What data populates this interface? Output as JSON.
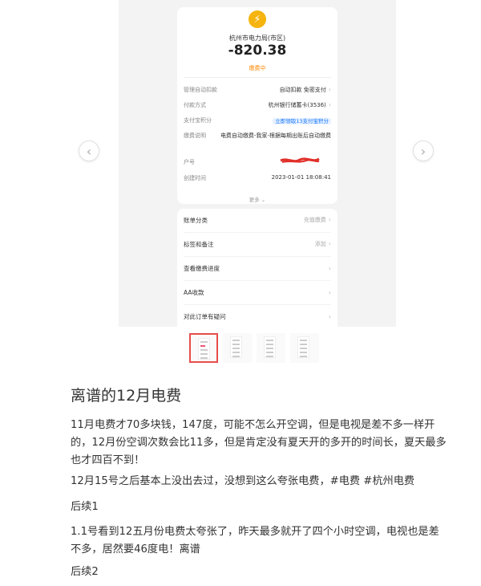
{
  "receipt": {
    "merchant": "杭州市电力局(市区)",
    "amount": "-820.38",
    "status": "缴费中",
    "rows": [
      {
        "label": "管理自动扣款",
        "value": "自动扣款 免密支付"
      },
      {
        "label": "付款方式",
        "value": "杭州银行储蓄卡(3536)"
      },
      {
        "label": "支付宝积分",
        "value": "立即领取13支付宝积分"
      },
      {
        "label": "缴费说明",
        "value": "电费自动缴费-我家-根据每期出账后自动缴费"
      },
      {
        "label": "户号",
        "value": ""
      },
      {
        "label": "创建时间",
        "value": "2023-01-01 18:08:41"
      }
    ],
    "more": "更多 ⌄"
  },
  "menu": [
    {
      "label": "账单分类",
      "hint": "充值缴费"
    },
    {
      "label": "标签和备注",
      "hint": "添加"
    },
    {
      "label": "查看缴费进度",
      "hint": ""
    },
    {
      "label": "AA收款",
      "hint": ""
    },
    {
      "label": "对此订单有疑问",
      "hint": ""
    }
  ],
  "icons": {
    "prev": "chevron-left-icon",
    "next": "chevron-right-icon",
    "bolt": "lightning-icon"
  },
  "colors": {
    "accent": "#f5b40e",
    "status": "#ff8a00",
    "thumb_active": "#e94c4c",
    "badge": "#1677ff"
  },
  "post": {
    "title": "离谱的12月电费",
    "paragraphs": [
      "11月电费才70多块钱，147度，可能不怎么开空调，但是电视是差不多一样开的，12月份空调次数会比11多，但是肯定没有夏天开的多开的时间长，夏天最多也才四百不到！",
      "12月15号之后基本上没出去过，没想到这么夸张电费，#电费 #杭州电费",
      "后续1",
      "1.1号看到12五月份电费太夸张了，昨天最多就开了四个小时空调，电视也是差不多，居然要46度电！离谱",
      "后续2"
    ]
  }
}
